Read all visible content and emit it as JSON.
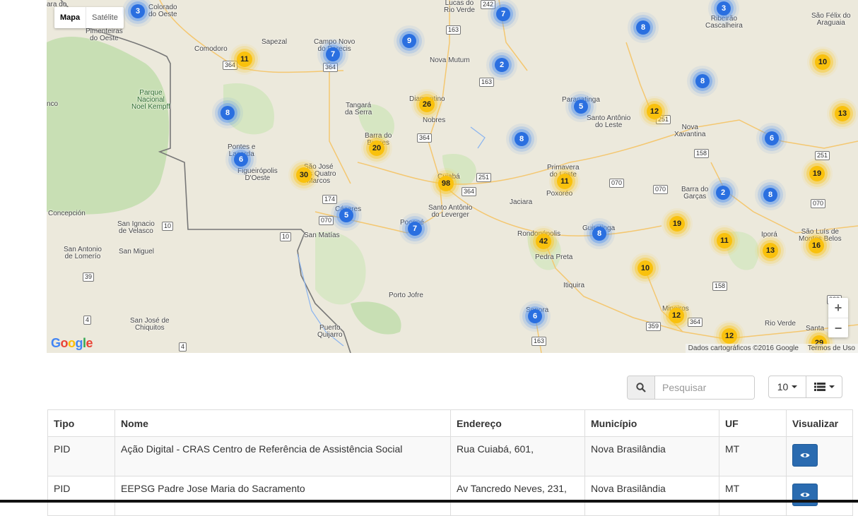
{
  "map": {
    "type_controls": [
      {
        "label": "Mapa",
        "active": true
      },
      {
        "label": "Satélite",
        "active": false
      }
    ],
    "places": [
      {
        "name": "Colorado\ndo Oeste"
      },
      {
        "name": "Pimenteiras\ndo Oeste"
      },
      {
        "name": "Comodoro"
      },
      {
        "name": "Sapezal"
      },
      {
        "name": "Campo Novo\ndo Parecis"
      },
      {
        "name": "Lucas do\nRio Verde"
      },
      {
        "name": "Nova Mutum"
      },
      {
        "name": "Parque\nNacional\nNoel Kempff"
      },
      {
        "name": "Tangará\nda Serra"
      },
      {
        "name": "Diamantino"
      },
      {
        "name": "Nobres"
      },
      {
        "name": "Barra do\nBugres"
      },
      {
        "name": "Pontes e\nLacerda"
      },
      {
        "name": "Figueirópolis\nD'Oeste"
      },
      {
        "name": "São José\ndos Quatro\nMarcos"
      },
      {
        "name": "Cuiabá"
      },
      {
        "name": "Santo Antônio\ndo Leverger"
      },
      {
        "name": "Cáceres"
      },
      {
        "name": "Poconé"
      },
      {
        "name": "Concepción"
      },
      {
        "name": "San Ignacio\nde Velasco"
      },
      {
        "name": "San Matías"
      },
      {
        "name": "San Antonio\nde Lomerío"
      },
      {
        "name": "San Miguel"
      },
      {
        "name": "San José de\nChiquitos"
      },
      {
        "name": "Porto Jofre"
      },
      {
        "name": "Puerto\nQuijarro"
      },
      {
        "name": "Paranatinga"
      },
      {
        "name": "Santo Antônio\ndo Leste"
      },
      {
        "name": "Primavera\ndo Leste"
      },
      {
        "name": "Poxoréo"
      },
      {
        "name": "Jaciara"
      },
      {
        "name": "Rondonópolis"
      },
      {
        "name": "Pedra Preta"
      },
      {
        "name": "Guiratinga"
      },
      {
        "name": "Itiquira"
      },
      {
        "name": "Sonora"
      },
      {
        "name": "Mineiros"
      },
      {
        "name": "Nova\nXavantina"
      },
      {
        "name": "Barra do\nGarças"
      },
      {
        "name": "Iporá"
      },
      {
        "name": "São Luís de\nMontes Belos"
      },
      {
        "name": "Rio Verde"
      },
      {
        "name": "Santa"
      },
      {
        "name": "São Félix do\nAraguaia"
      },
      {
        "name": "Ribeirão\nCascalheira"
      },
      {
        "name": "ara do"
      },
      {
        "name": "nco"
      }
    ],
    "clusters": [
      {
        "count": "3",
        "color": "blue"
      },
      {
        "count": "7",
        "color": "blue"
      },
      {
        "count": "8",
        "color": "blue"
      },
      {
        "count": "3",
        "color": "blue"
      },
      {
        "count": "11",
        "color": "yellow"
      },
      {
        "count": "7",
        "color": "blue"
      },
      {
        "count": "9",
        "color": "blue"
      },
      {
        "count": "2",
        "color": "blue"
      },
      {
        "count": "10",
        "color": "yellow"
      },
      {
        "count": "8",
        "color": "blue"
      },
      {
        "count": "8",
        "color": "blue"
      },
      {
        "count": "26",
        "color": "yellow"
      },
      {
        "count": "5",
        "color": "blue"
      },
      {
        "count": "12",
        "color": "yellow"
      },
      {
        "count": "13",
        "color": "yellow"
      },
      {
        "count": "20",
        "color": "yellow"
      },
      {
        "count": "8",
        "color": "blue"
      },
      {
        "count": "6",
        "color": "blue"
      },
      {
        "count": "6",
        "color": "blue"
      },
      {
        "count": "30",
        "color": "yellow"
      },
      {
        "count": "98",
        "color": "yellow"
      },
      {
        "count": "11",
        "color": "yellow"
      },
      {
        "count": "19",
        "color": "yellow"
      },
      {
        "count": "2",
        "color": "blue"
      },
      {
        "count": "8",
        "color": "blue"
      },
      {
        "count": "5",
        "color": "blue"
      },
      {
        "count": "7",
        "color": "blue"
      },
      {
        "count": "8",
        "color": "blue"
      },
      {
        "count": "42",
        "color": "yellow"
      },
      {
        "count": "19",
        "color": "yellow"
      },
      {
        "count": "11",
        "color": "yellow"
      },
      {
        "count": "13",
        "color": "yellow"
      },
      {
        "count": "16",
        "color": "yellow"
      },
      {
        "count": "10",
        "color": "yellow"
      },
      {
        "count": "6",
        "color": "blue"
      },
      {
        "count": "12",
        "color": "yellow"
      },
      {
        "count": "12",
        "color": "yellow"
      },
      {
        "count": "29",
        "color": "yellow"
      }
    ],
    "road_shields": [
      "364",
      "364",
      "242",
      "163",
      "163",
      "364",
      "251",
      "364",
      "251",
      "174",
      "070",
      "10",
      "10",
      "39",
      "4",
      "4",
      "070",
      "070",
      "251",
      "158",
      "070",
      "359",
      "364",
      "060",
      "158",
      "163"
    ],
    "zoom_in_label": "+",
    "zoom_out_label": "−",
    "google_logo": "Google",
    "attribution": "Dados cartográficos ©2016 Google",
    "terms": "Termos de Uso"
  },
  "toolbar": {
    "search_placeholder": "Pesquisar",
    "page_size": "10"
  },
  "table": {
    "headers": [
      "Tipo",
      "Nome",
      "Endereço",
      "Município",
      "UF",
      "Visualizar"
    ],
    "rows": [
      {
        "tipo": "PID",
        "nome": "Ação Digital - CRAS Centro de Referência de Assistência Social",
        "endereco": "Rua Cuiabá, 601,",
        "municipio": "Nova Brasilândia",
        "uf": "MT"
      },
      {
        "tipo": "PID",
        "nome": "EEPSG Padre Jose Maria do Sacramento",
        "endereco": "Av Tancredo Neves, 231,",
        "municipio": "Nova Brasilândia",
        "uf": "MT"
      }
    ]
  },
  "colors": {
    "cluster_blue": "#2a6fe0",
    "cluster_yellow": "#f9c10d",
    "view_button": "#2a6bb0"
  }
}
